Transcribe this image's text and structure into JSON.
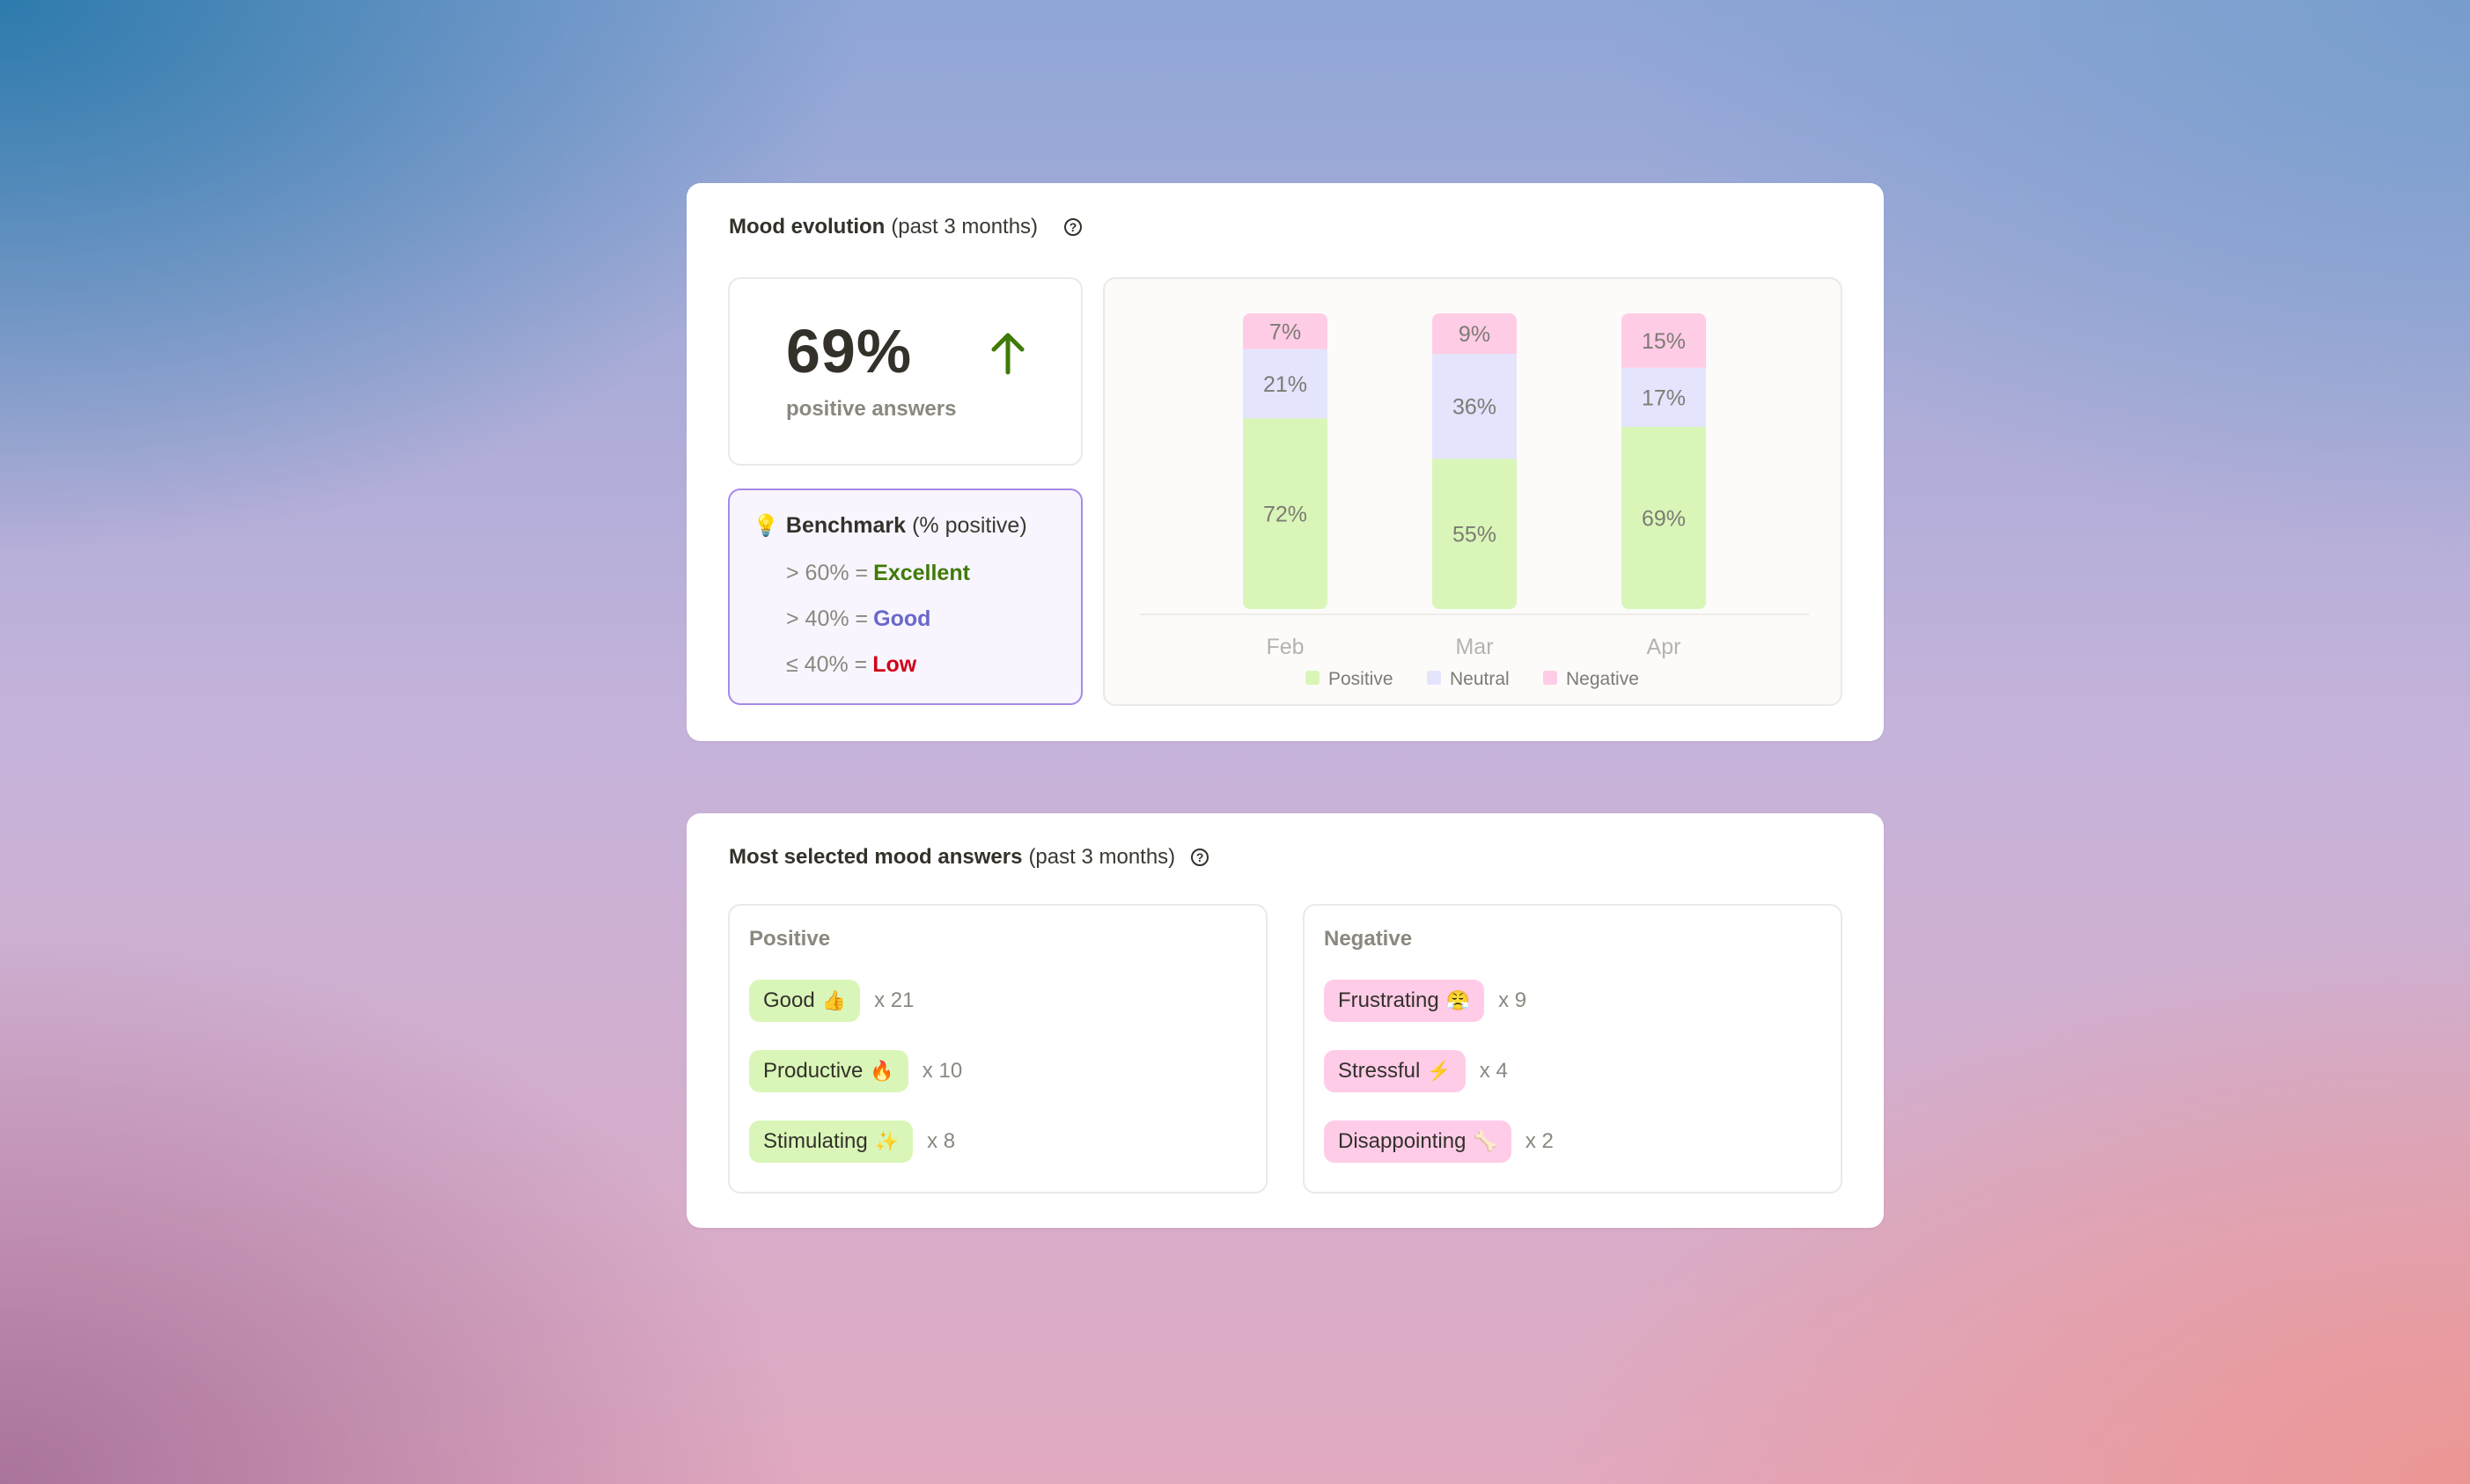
{
  "mood_evolution": {
    "title_bold": "Mood evolution",
    "title_sub": "(past 3 months)",
    "help_icon": "?",
    "stat": {
      "value": "69%",
      "label": "positive answers",
      "trend": "up",
      "trend_color": "#3f7a06"
    },
    "benchmark": {
      "icon": "💡",
      "title_bold": "Benchmark",
      "title_sub": "(% positive)",
      "rows": [
        {
          "rule": "> 60% =",
          "level": "Excellent",
          "color": "#3f7a06"
        },
        {
          "rule": "> 40% =",
          "level": "Good",
          "color": "#6a68c9"
        },
        {
          "rule": "≤ 40% =",
          "level": "Low",
          "color": "#d0021b"
        }
      ]
    }
  },
  "chart_data": {
    "type": "bar",
    "stacked": true,
    "title": "",
    "xlabel": "",
    "ylabel": "",
    "ylim": [
      0,
      100
    ],
    "grid": false,
    "legend_position": "bottom",
    "categories": [
      "Feb",
      "Mar",
      "Apr"
    ],
    "series": [
      {
        "name": "Positive",
        "color": "#d9f6b8",
        "values": [
          72,
          55,
          69
        ],
        "labels": [
          "72%",
          "55%",
          "69%"
        ]
      },
      {
        "name": "Neutral",
        "color": "#e4e4fd",
        "values": [
          21,
          36,
          17
        ],
        "labels": [
          "21%",
          "36%",
          "17%"
        ]
      },
      {
        "name": "Negative",
        "color": "#ffcce6",
        "values": [
          7,
          9,
          15
        ],
        "labels": [
          "7%",
          "9%",
          "15%"
        ]
      }
    ]
  },
  "mood_answers": {
    "title_bold": "Most selected mood answers",
    "title_sub": "(past 3 months)",
    "help_icon": "?",
    "positive": {
      "title": "Positive",
      "items": [
        {
          "label": "Good",
          "emoji": "👍",
          "count": "x 21"
        },
        {
          "label": "Productive",
          "emoji": "🔥",
          "count": "x 10"
        },
        {
          "label": "Stimulating",
          "emoji": "✨",
          "count": "x 8"
        }
      ]
    },
    "negative": {
      "title": "Negative",
      "items": [
        {
          "label": "Frustrating",
          "emoji": "😤",
          "count": "x 9"
        },
        {
          "label": "Stressful",
          "emoji": "⚡",
          "count": "x 4"
        },
        {
          "label": "Disappointing",
          "emoji": "🦴",
          "count": "x 2"
        }
      ]
    }
  }
}
